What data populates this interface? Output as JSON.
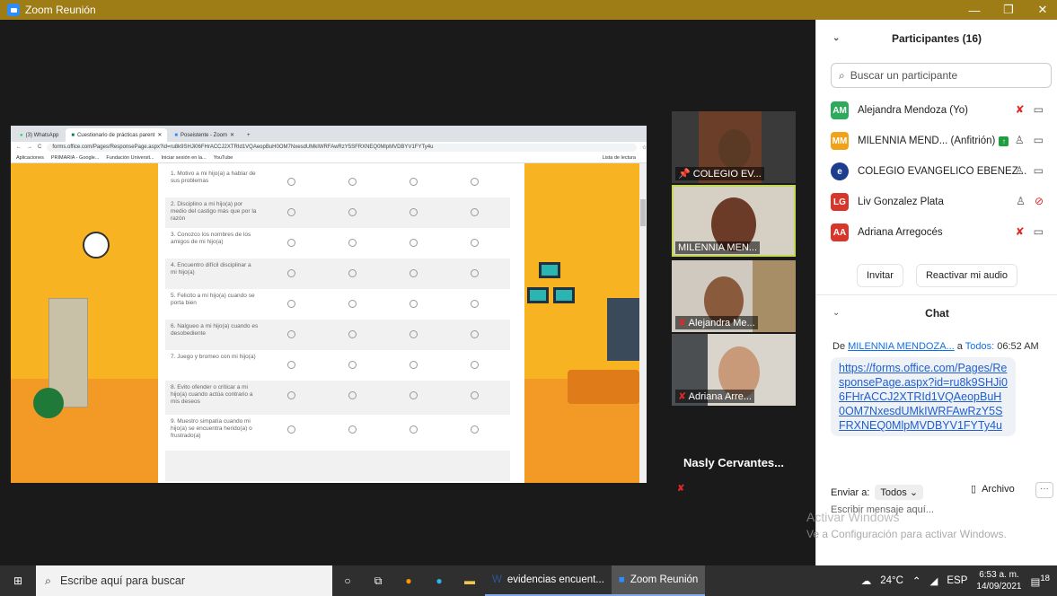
{
  "window": {
    "title": "Zoom Reunión"
  },
  "browser": {
    "tabs": [
      "(3) WhatsApp",
      "Cuestionario de prácticas parent",
      "Poseistente - Zoom"
    ],
    "url": "forms.office.com/Pages/ResponsePage.aspx?id=ru8k9SHJi06FHrACCJ2XTRId1VQAeopBuH0OM7NxesdUMkIWRFAwRzY5SFRXNEQ0MlpMVDBYV1FYTy4u",
    "bookmarks": [
      "Aplicaciones",
      "PRIMARIA - Google...",
      "Fundación Universit...",
      "Iniciar sesión en la...",
      "YouTube"
    ],
    "reading_list": "Lista de lectura"
  },
  "form": {
    "questions": [
      "1. Motivo a mi hijo(a) a hablar de sus problemas",
      "2. Disciplino a mi hijo(a) por medio del castigo más que por la razón",
      "3. Conozco los nombres de los amigos de mi hijo(a)",
      "4. Encuentro difícil disciplinar a mi hijo(a)",
      "5. Felicito a mi hijo(a) cuando se porta bien",
      "6. Nalgueo a mi hijo(a) cuando es desobediente",
      "7. Juego y bromeo con mi hijo(a)",
      "8. Evito ofender o criticar a mi hijo(a) cuando actúa contrario a mis deseos",
      "9. Muestro simpatía cuando mi hijo(a) se encuentra herido(a) o frustrado(a)"
    ]
  },
  "videos": [
    {
      "name": "COLEGIO EV..."
    },
    {
      "name": "MILENNIA MEN..."
    },
    {
      "name": "Alejandra Me..."
    },
    {
      "name": "Adriana Arre..."
    },
    {
      "name": "Nasly Cervantes..."
    }
  ],
  "participants": {
    "header": "Participantes (16)",
    "search_placeholder": "Buscar un participante",
    "list": [
      {
        "initials": "AM",
        "name": "Alejandra Mendoza (Yo)",
        "color": "#2eaa5c"
      },
      {
        "initials": "MM",
        "name": "MILENNIA MEND... (Anfitrión)",
        "color": "#f0a21a"
      },
      {
        "initials": "",
        "name": "COLEGIO EVANGELICO EBENEZ...",
        "color": "#1d3d8f"
      },
      {
        "initials": "LG",
        "name": "Liv Gonzalez Plata",
        "color": "#d9362b"
      },
      {
        "initials": "AA",
        "name": "Adriana Arregocés",
        "color": "#d9362b"
      }
    ],
    "invite_label": "Invitar",
    "unmute_label": "Reactivar mi audio"
  },
  "chat": {
    "header": "Chat",
    "from_prefix": "De",
    "from": "MILENNIA MENDOZA...",
    "to_prefix": "a",
    "to": "Todos:",
    "time": "06:52 AM",
    "message": "https://forms.office.com/Pages/ResponsePage.aspx?id=ru8k9SHJi06FHrACCJ2XTRId1VQAeopBuH0OM7NxesdUMkIWRFAwRzY5SFRXNEQ0MlpMVDBYV1FYTy4u",
    "send_to_label": "Enviar a:",
    "send_to_value": "Todos",
    "file_label": "Archivo",
    "input_placeholder": "Escribir mensaje aquí..."
  },
  "watermark": {
    "line1": "Activar Windows",
    "line2": "Ve a Configuración para activar Windows."
  },
  "taskbar": {
    "search_placeholder": "Escribe aquí para buscar",
    "apps": [
      "evidencias encuent...",
      "Zoom Reunión"
    ],
    "temperature": "24°C",
    "language": "ESP",
    "time": "6:53 a. m.",
    "date": "14/09/2021",
    "notifications": "18"
  }
}
